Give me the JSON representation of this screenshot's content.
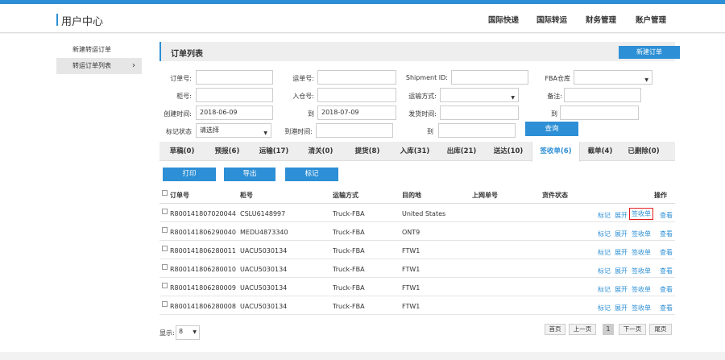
{
  "header": {
    "title": "用户中心",
    "nav": [
      "国际快递",
      "国际转运",
      "财务管理",
      "账户管理"
    ]
  },
  "sidebar": {
    "items": [
      {
        "label": "新建转运订单"
      },
      {
        "label": "转运订单列表"
      }
    ]
  },
  "panel": {
    "title": "订单列表",
    "new_button": "新建订单"
  },
  "filters": {
    "order_no_label": "订单号:",
    "tracking_no_label": "运单号:",
    "shipment_id_label": "Shipment ID:",
    "fba_warehouse_label": "FBA仓库",
    "container_no_label": "柜号:",
    "inbound_no_label": "入仓号:",
    "transport_label": "运输方式:",
    "remark_label": "备注:",
    "created_label": "创建时间:",
    "created_from": "2018-06-09",
    "to_label": "到",
    "created_to": "2018-07-09",
    "ship_time_label": "发货时间:",
    "ship_to_label": "到",
    "mark_status_label": "标记状态",
    "mark_status_value": "请选择",
    "arrive_label": "到港时间:",
    "arrive_to_label": "到",
    "query_button": "查询"
  },
  "tabs": [
    {
      "label": "草稿(0)"
    },
    {
      "label": "预报(6)"
    },
    {
      "label": "运输(17)"
    },
    {
      "label": "清关(0)"
    },
    {
      "label": "提货(8)"
    },
    {
      "label": "入库(31)"
    },
    {
      "label": "出库(21)"
    },
    {
      "label": "送达(10)"
    },
    {
      "label": "签收单(6)"
    },
    {
      "label": "截单(4)"
    },
    {
      "label": "已删除(0)"
    }
  ],
  "actions": {
    "print": "打印",
    "export": "导出",
    "mark": "标记"
  },
  "table": {
    "headers": [
      "订单号",
      "柜号",
      "运输方式",
      "目的地",
      "上网单号",
      "货件状态",
      "操作"
    ],
    "rows": [
      {
        "order": "R800141807020044",
        "container": "CSLU6148997",
        "transport": "Truck-FBA",
        "dest": "United States"
      },
      {
        "order": "R800141806290040",
        "container": "MEDU4873340",
        "transport": "Truck-FBA",
        "dest": "ONT9"
      },
      {
        "order": "R800141806280011",
        "container": "UACU5030134",
        "transport": "Truck-FBA",
        "dest": "FTW1"
      },
      {
        "order": "R800141806280010",
        "container": "UACU5030134",
        "transport": "Truck-FBA",
        "dest": "FTW1"
      },
      {
        "order": "R800141806280009",
        "container": "UACU5030134",
        "transport": "Truck-FBA",
        "dest": "FTW1"
      },
      {
        "order": "R800141806280008",
        "container": "UACU5030134",
        "transport": "Truck-FBA",
        "dest": "FTW1"
      }
    ],
    "ops": [
      "标记",
      "展开",
      "签收单",
      "查看"
    ]
  },
  "pager": {
    "show_label": "显示:",
    "page_size": "8",
    "first": "首页",
    "prev": "上一页",
    "current": "1",
    "next": "下一页",
    "last": "尾页"
  }
}
